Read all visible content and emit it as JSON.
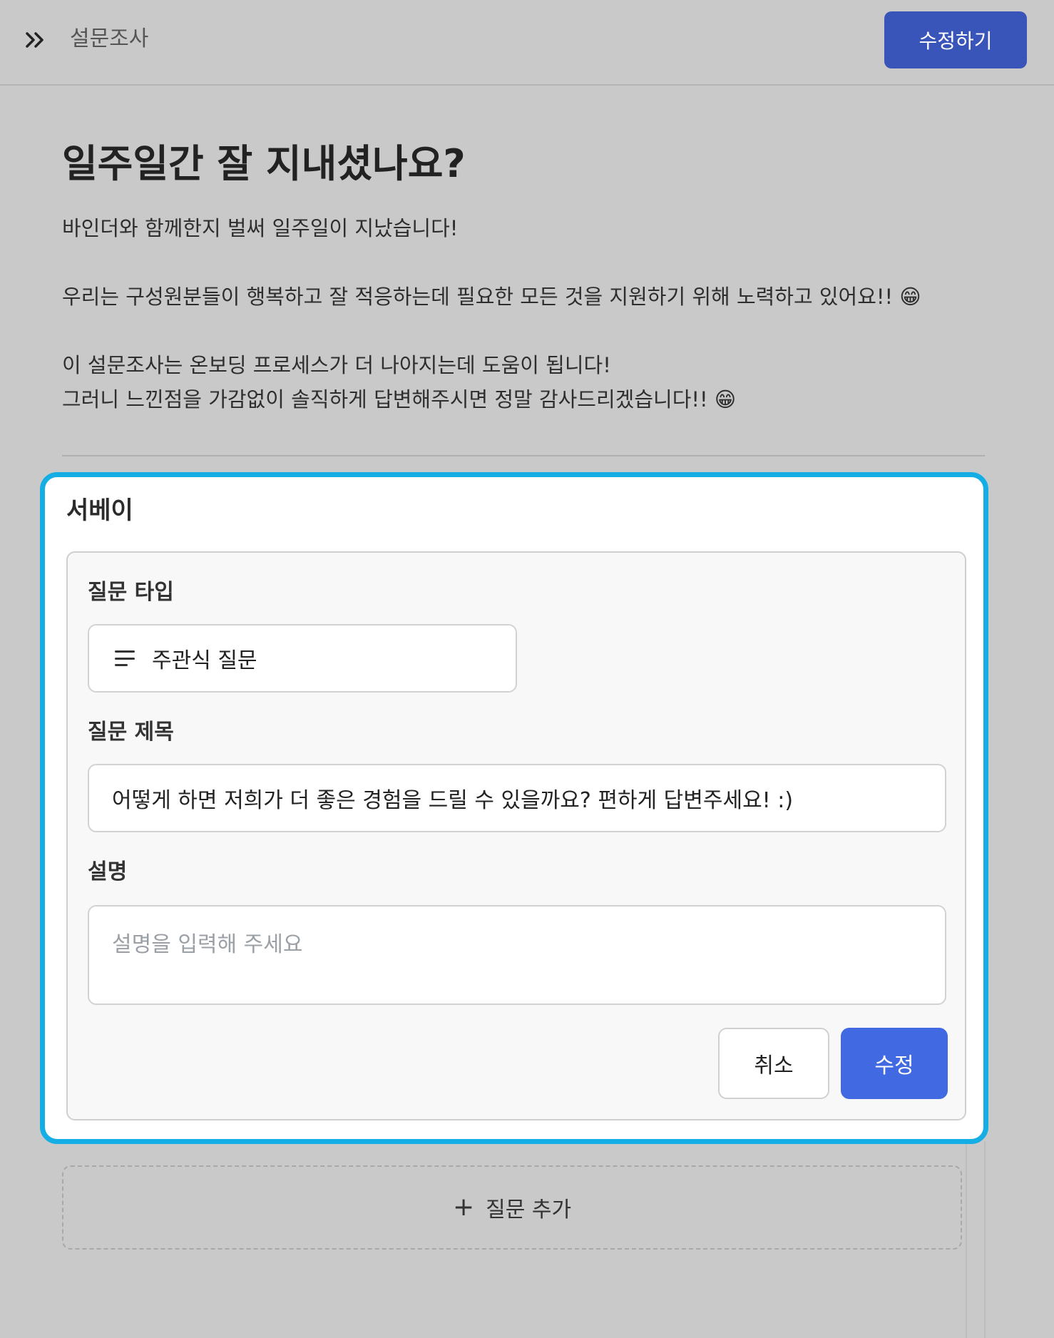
{
  "header": {
    "breadcrumb": "설문조사",
    "edit_button": "수정하기"
  },
  "intro": {
    "title": "일주일간 잘 지내셨나요?",
    "paragraphs": [
      "바인더와 함께한지 벌써 일주일이 지났습니다!",
      "우리는 구성원분들이 행복하고 잘 적응하는데 필요한 모든 것을 지원하기 위해 노력하고 있어요!! 😁",
      "이 설문조사는 온보딩 프로세스가 더 나아지는데 도움이 됩니다!",
      "그러니 느낀점을 가감없이 솔직하게 답변해주시면 정말 감사드리겠습니다!! 😁"
    ]
  },
  "panel": {
    "title": "서베이",
    "question_type_label": "질문 타입",
    "question_type_value": "주관식 질문",
    "question_title_label": "질문 제목",
    "question_title_value": "어떻게 하면 저희가 더 좋은 경험을 드릴 수 있을까요? 편하게 답변주세요! :)",
    "description_label": "설명",
    "description_placeholder": "설명을 입력해 주세요",
    "cancel_button": "취소",
    "save_button": "수정"
  },
  "add_question": {
    "label": "질문 추가"
  },
  "colors": {
    "accent": "#4169e1",
    "header_button": "#3a55b9",
    "focus_border": "#14aee5"
  }
}
